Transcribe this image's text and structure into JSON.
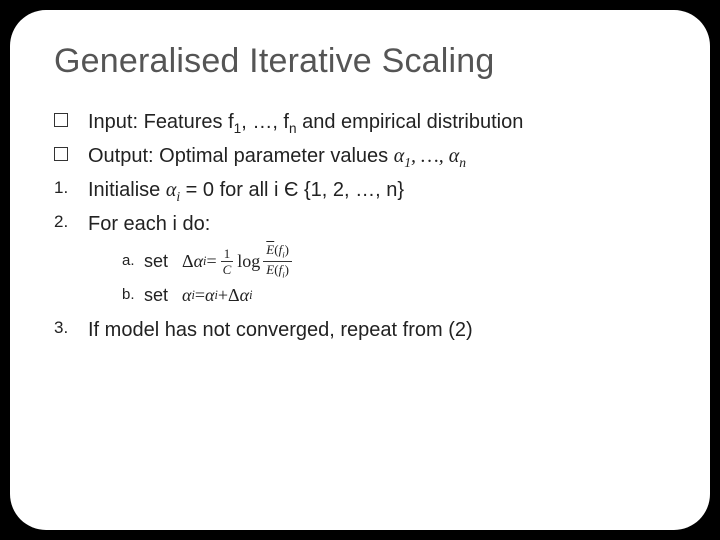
{
  "title": "Generalised Iterative Scaling",
  "items": {
    "input_prefix": "Input: Features f",
    "input_mid": ", …, f",
    "input_suffix": " and empirical distribution",
    "output_prefix": "Output: Optimal parameter values ",
    "output_mid": ", …, ",
    "init_prefix": "Initialise ",
    "init_mid": " = 0 for all i ",
    "init_elem": "Є",
    "init_set": " {1, 2, …, n}",
    "foreach": "For each i do:",
    "set_a": "set",
    "set_b": "set",
    "step3": "If model has not converged, repeat from (2)"
  },
  "markers": {
    "one": "1.",
    "two": "2.",
    "three": "3.",
    "a": "a.",
    "b": "b."
  },
  "sym": {
    "alpha": "α",
    "sub1": "1",
    "subn": "n",
    "subi": "i",
    "Delta": "Δ",
    "eq": " = ",
    "plus": " + ",
    "oneOverC_num": "1",
    "oneOverC_den": "C",
    "log": "log",
    "Ebar": "E",
    "E": "E",
    "fi": "f",
    "lp": "(",
    "rp": ")"
  }
}
